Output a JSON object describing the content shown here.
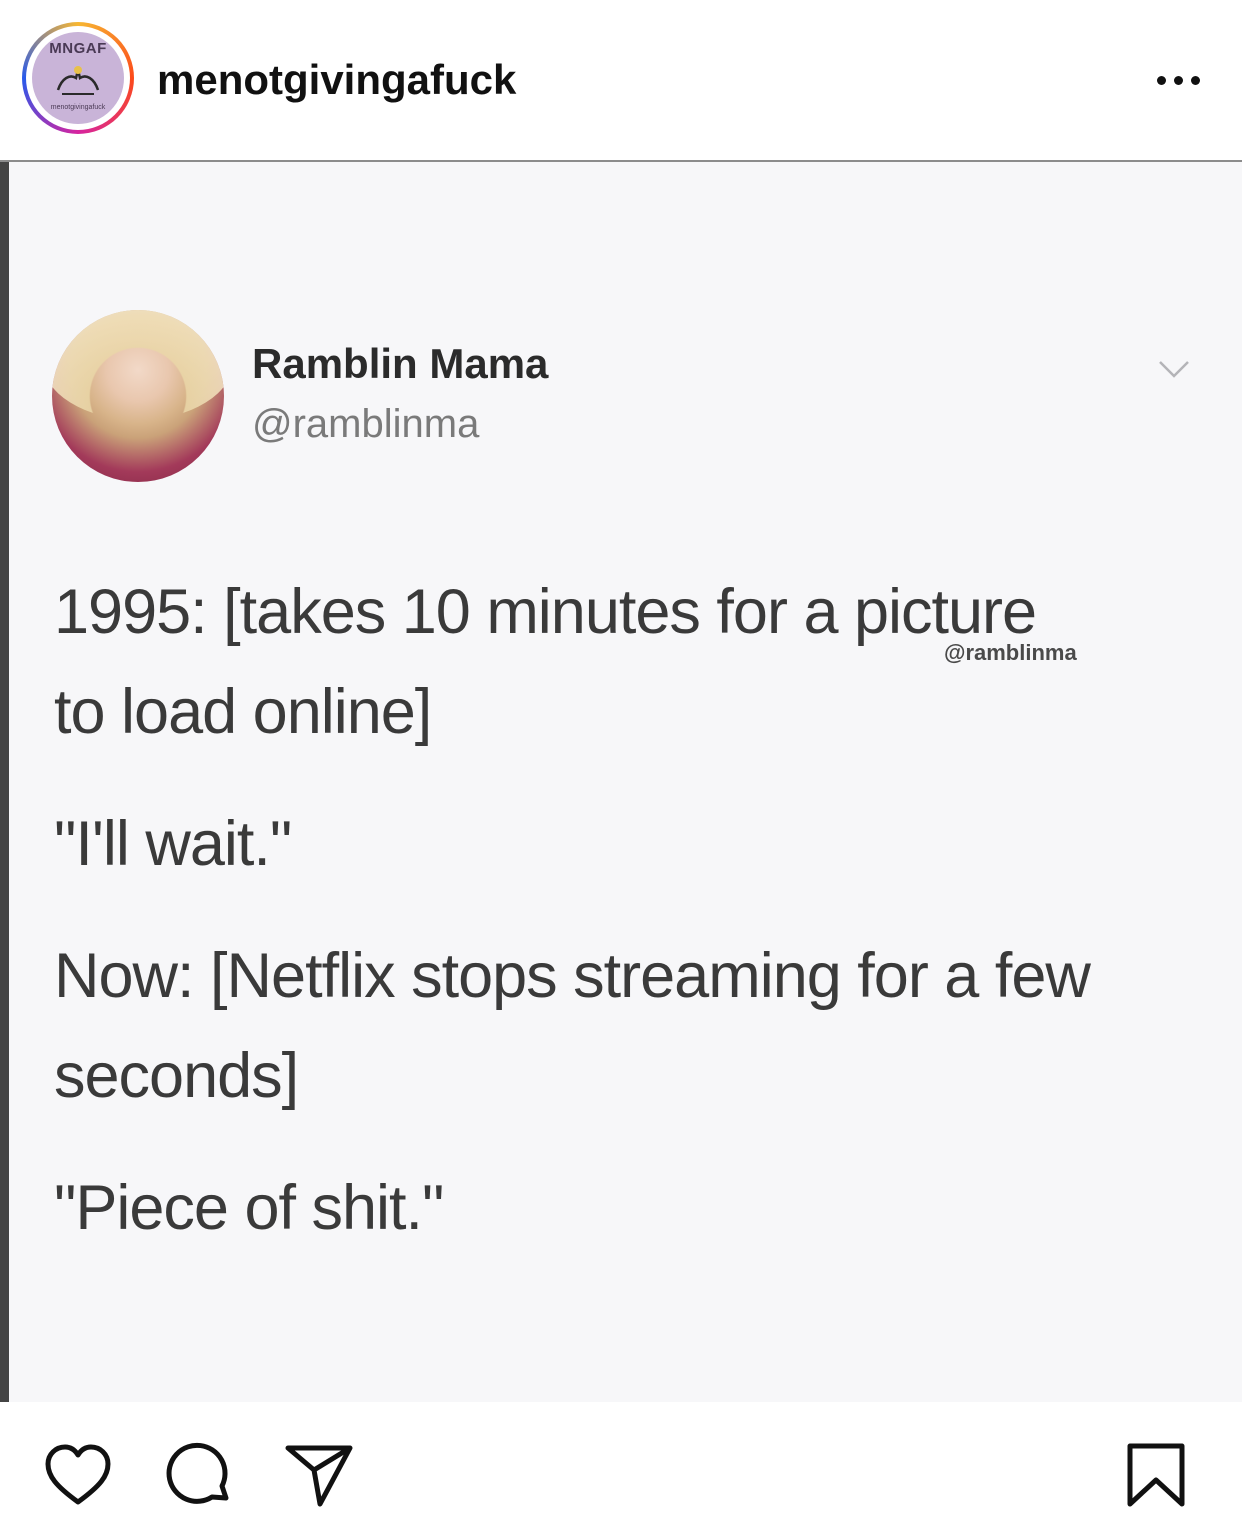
{
  "header": {
    "avatar_brand": "MNGAF",
    "avatar_subtext": "menotgivingafuck",
    "username": "menotgivingafuck",
    "more_icon": "more-horizontal-icon"
  },
  "tweet": {
    "display_name": "Ramblin Mama",
    "handle": "@ramblinma",
    "lines": [
      "1995: [takes 10 minutes for a picture",
      "to load online]",
      "\"I'll wait.\"",
      "Now: [Netflix stops streaming for a few",
      "seconds]",
      "\"Piece of shit.\""
    ],
    "watermark": "@ramblinma",
    "chevron_icon": "chevron-down-icon"
  },
  "actions": {
    "icons": [
      "heart-icon",
      "comment-icon",
      "share-icon",
      "bookmark-icon"
    ]
  }
}
